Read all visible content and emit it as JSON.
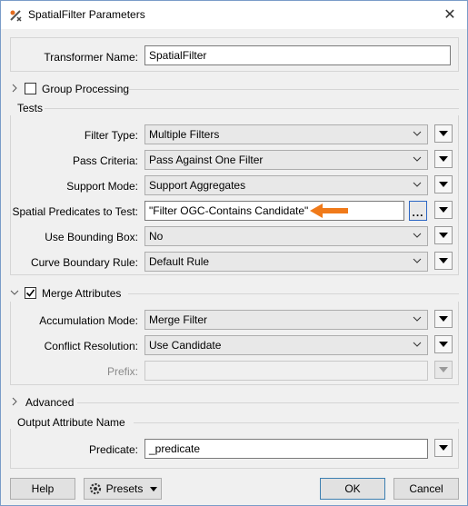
{
  "window": {
    "title": "SpatialFilter Parameters",
    "icons": {
      "app": "spatialfilter-icon",
      "close": "close-icon"
    }
  },
  "transformer": {
    "label": "Transformer Name:",
    "value": "SpatialFilter"
  },
  "group_processing": {
    "label": "Group Processing",
    "checked": false
  },
  "tests": {
    "heading": "Tests",
    "filter_type": {
      "label": "Filter Type:",
      "value": "Multiple Filters"
    },
    "pass_criteria": {
      "label": "Pass Criteria:",
      "value": "Pass Against One Filter"
    },
    "support_mode": {
      "label": "Support Mode:",
      "value": "Support Aggregates"
    },
    "spatial_predicates": {
      "label": "Spatial Predicates to Test:",
      "value": "\"Filter OGC-Contains Candidate\"",
      "browse_label": "..."
    },
    "use_bounding_box": {
      "label": "Use Bounding Box:",
      "value": "No"
    },
    "curve_boundary": {
      "label": "Curve Boundary Rule:",
      "value": "Default Rule"
    }
  },
  "merge_attributes": {
    "label": "Merge Attributes",
    "checked": true,
    "accumulation_mode": {
      "label": "Accumulation Mode:",
      "value": "Merge Filter"
    },
    "conflict_resolution": {
      "label": "Conflict Resolution:",
      "value": "Use Candidate"
    },
    "prefix": {
      "label": "Prefix:",
      "value": ""
    }
  },
  "advanced": {
    "label": "Advanced"
  },
  "output": {
    "heading": "Output Attribute Name",
    "predicate": {
      "label": "Predicate:",
      "value": "_predicate"
    }
  },
  "buttons": {
    "help": "Help",
    "presets": "Presets",
    "ok": "OK",
    "cancel": "Cancel"
  },
  "colors": {
    "annotation_arrow": "#f07a1a",
    "window_border": "#7a9cc8"
  }
}
